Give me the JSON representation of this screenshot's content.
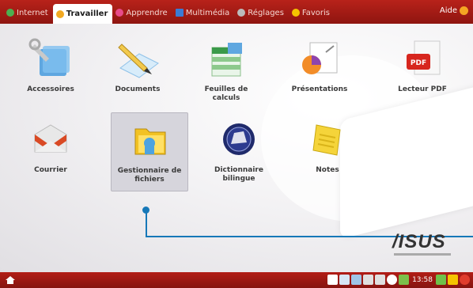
{
  "tabs": [
    {
      "label": "Internet",
      "color": "#4caf50",
      "active": false
    },
    {
      "label": "Travailler",
      "color": "#f2a922",
      "active": true
    },
    {
      "label": "Apprendre",
      "color": "#e84b8a",
      "active": false
    },
    {
      "label": "Multimédia",
      "color": "#3a7bd5",
      "active": false
    },
    {
      "label": "Réglages",
      "color": "#bbbbbb",
      "active": false
    },
    {
      "label": "Favoris",
      "color": "#f5c400",
      "active": false
    }
  ],
  "help_label": "Aide",
  "apps": [
    {
      "label": "Accessoires",
      "icon": "tools-icon"
    },
    {
      "label": "Documents",
      "icon": "document-pencil-icon"
    },
    {
      "label": "Feuilles de\ncalculs",
      "icon": "spreadsheet-icon"
    },
    {
      "label": "Présentations",
      "icon": "presentation-icon"
    },
    {
      "label": "Lecteur PDF",
      "icon": "pdf-icon"
    },
    {
      "label": "Courrier",
      "icon": "mail-icon"
    },
    {
      "label": "Gestionnaire de\nfichiers",
      "icon": "folder-icon",
      "selected": true
    },
    {
      "label": "Dictionnaire\nbilingue",
      "icon": "dictionary-icon"
    },
    {
      "label": "Notes",
      "icon": "notes-icon"
    }
  ],
  "logo": "/ISUS",
  "taskbar": {
    "clock": "13:58"
  },
  "colors": {
    "accent": "#b8221a",
    "callout": "#1678b8"
  }
}
